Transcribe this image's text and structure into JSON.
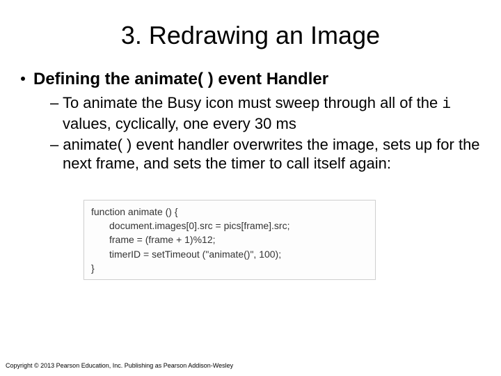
{
  "title": "3. Redrawing an Image",
  "bullet1": "Defining the animate( ) event Handler",
  "sub1_pre": "– To animate the Busy icon must sweep through all of the ",
  "sub1_code": "i",
  "sub1_post": " values, cyclically, one every 30 ms",
  "sub2": "– animate( ) event handler overwrites the image, sets up for the next frame, and sets the timer to call itself again:",
  "code": {
    "l1": "function animate () {",
    "l2": "document.images[0].src = pics[frame].src;",
    "l3": "frame = (frame + 1)%12;",
    "l4": "timerID = setTimeout (\"animate()\", 100);",
    "l5": "}"
  },
  "copyright": "Copyright © 2013 Pearson Education, Inc. Publishing as Pearson Addison-Wesley"
}
